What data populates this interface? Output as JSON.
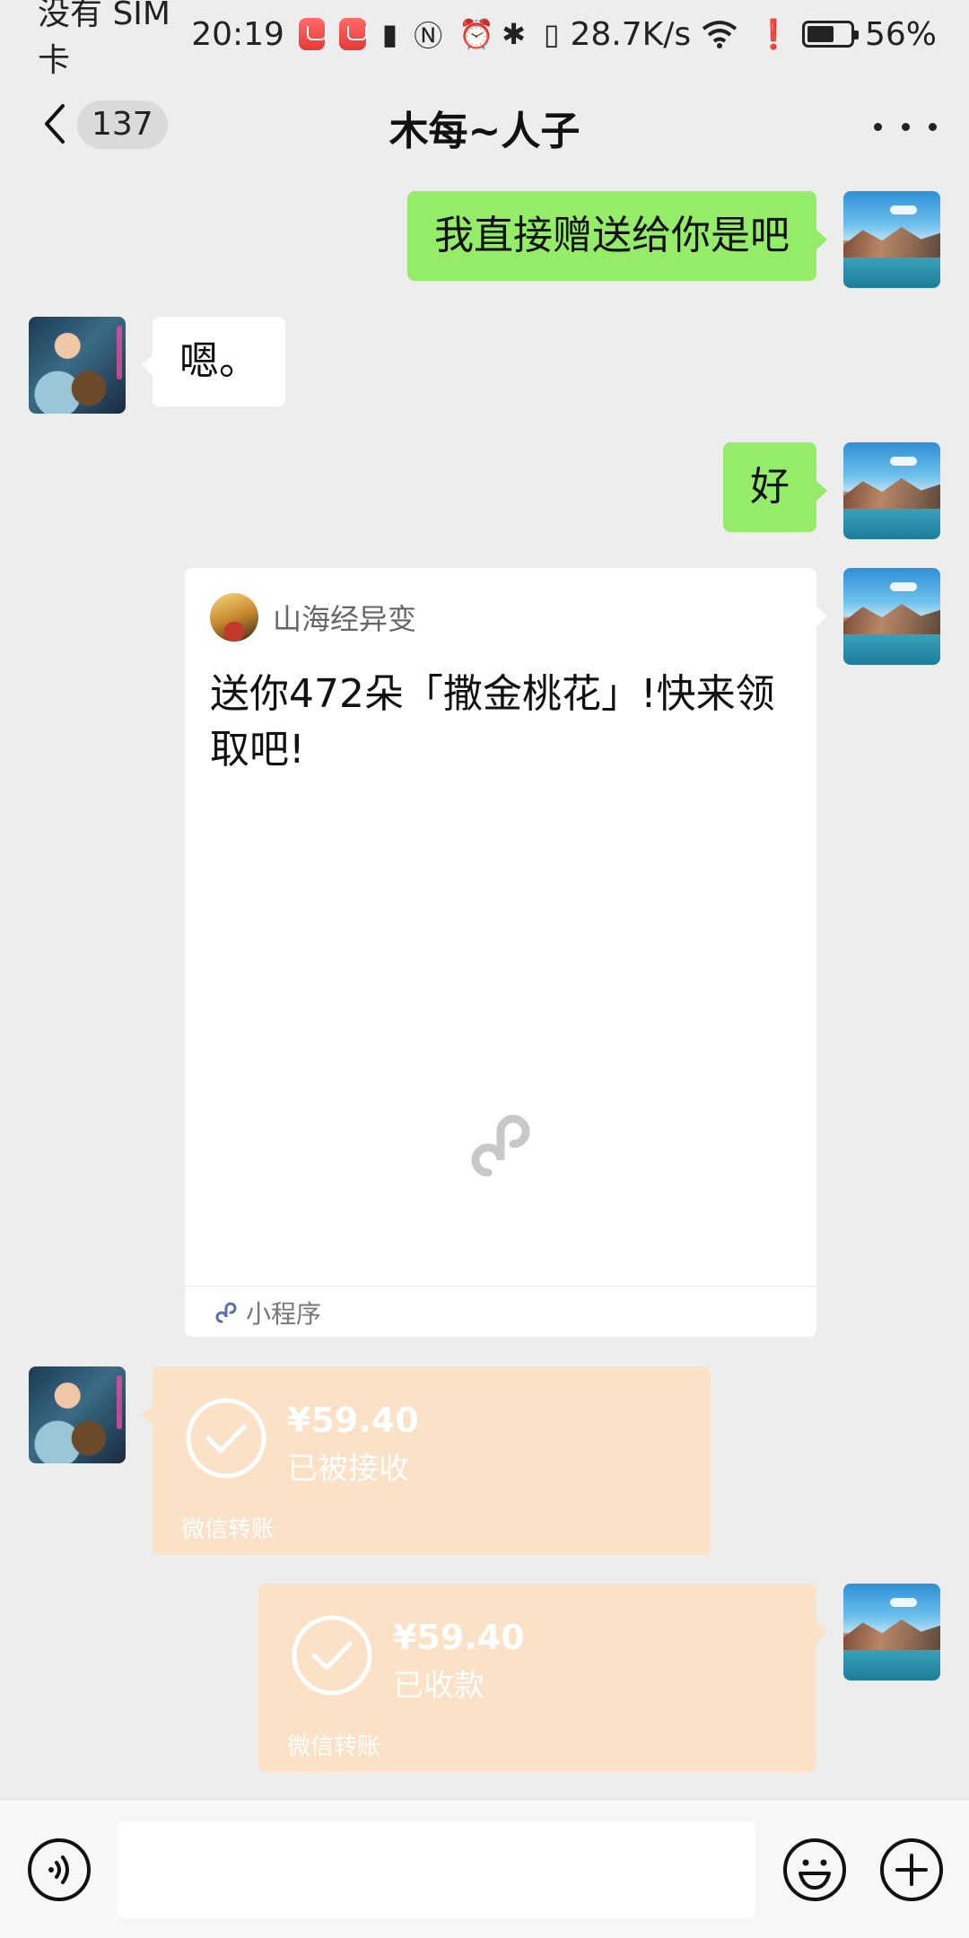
{
  "status_bar": {
    "carrier": "没有 SIM 卡",
    "time": "20:19",
    "network_speed": "28.7K/s",
    "battery_percent": "56%"
  },
  "nav": {
    "unread_count": "137",
    "title": "木每~人子"
  },
  "messages": [
    {
      "from": "self",
      "type": "text",
      "text": "我直接赠送给你是吧"
    },
    {
      "from": "other",
      "type": "text",
      "text": "嗯。"
    },
    {
      "from": "self",
      "type": "text",
      "text": "好"
    },
    {
      "from": "self",
      "type": "mini_program",
      "source": "山海经异变",
      "text": "送你472朵「撒金桃花」!快来领取吧!",
      "footer": "小程序"
    },
    {
      "from": "other",
      "type": "transfer",
      "amount": "¥59.40",
      "status": "已被接收",
      "label": "微信转账"
    },
    {
      "from": "self",
      "type": "transfer",
      "amount": "¥59.40",
      "status": "已收款",
      "label": "微信转账"
    }
  ],
  "input_bar": {
    "text": ""
  },
  "colors": {
    "background": "#ededed",
    "self_bubble": "#95ec69",
    "other_bubble": "#ffffff",
    "transfer_card": "#fbe1c5"
  }
}
